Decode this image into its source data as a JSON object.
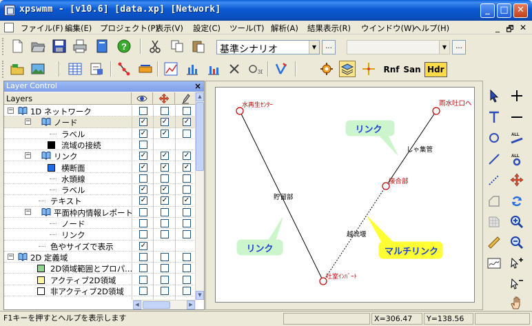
{
  "window": {
    "title": "xpswmm - [v10.6] [data.xp] [Network]",
    "min_glyph": "_",
    "max_glyph": "□",
    "close_glyph": "✕"
  },
  "menu": {
    "items": [
      "ファイル(F)",
      "編集(E)",
      "プロジェクト(P)",
      "表示(V)",
      "設定(C)",
      "ツール(T)",
      "解析(A)",
      "結果表示(R)",
      "ウインドウ(W)",
      "ヘルプ(H)"
    ],
    "mdi_min": "_",
    "mdi_restore": "🗗",
    "mdi_close": "✕"
  },
  "toolbar": {
    "scenario_value": "基準シナリオ",
    "second_combo_value": "",
    "dots": "...",
    "rnf_label": "Rnf",
    "san_label": "San",
    "hdr_label": "Hdr"
  },
  "layer_control": {
    "title": "Layer Control",
    "close_glyph": "×",
    "header_label": "Layers",
    "rows": [
      {
        "name": "1D ネットワーク",
        "c1": false,
        "c2": false,
        "c3": false
      },
      {
        "name": "ノード",
        "c1": true,
        "c2": true,
        "c3": true
      },
      {
        "name": "ラベル",
        "c1": true,
        "c2": true,
        "c3": false
      },
      {
        "name": "流域の接続",
        "c1": false,
        "c2": null,
        "c3": null
      },
      {
        "name": "リンク",
        "c1": true,
        "c2": true,
        "c3": true
      },
      {
        "name": "横断面",
        "c1": true,
        "c2": true,
        "c3": true
      },
      {
        "name": "水頭線",
        "c1": false,
        "c2": false,
        "c3": false
      },
      {
        "name": "ラベル",
        "c1": true,
        "c2": true,
        "c3": false
      },
      {
        "name": "テキスト",
        "c1": true,
        "c2": true,
        "c3": true
      },
      {
        "name": "平面枠内情報レポート",
        "c1": false,
        "c2": false,
        "c3": false
      },
      {
        "name": "ノード",
        "c1": false,
        "c2": false,
        "c3": false
      },
      {
        "name": "リンク",
        "c1": false,
        "c2": false,
        "c3": false
      },
      {
        "name": "色やサイズで表示",
        "c1": true,
        "c2": null,
        "c3": null
      },
      {
        "name": "2D 定義域",
        "c1": false,
        "c2": false,
        "c3": false
      },
      {
        "name": "2D領域範囲とプロパ...",
        "c1": false,
        "c2": false,
        "c3": false
      },
      {
        "name": "アクティブ2D領域",
        "c1": false,
        "c2": false,
        "c3": false
      },
      {
        "name": "非アクティブ2D領域",
        "c1": false,
        "c2": false,
        "c3": false
      }
    ]
  },
  "network": {
    "nodes": [
      {
        "label": "水再生ｾﾝﾀｰ"
      },
      {
        "label": "雨水吐口へ"
      },
      {
        "label": "接合部"
      },
      {
        "label": "吐室ｲﾝﾊﾞｰﾄ"
      }
    ],
    "link_labels": [
      "貯留部",
      "しゃ集管",
      "越流堰"
    ],
    "callouts": {
      "link_top": "リンク",
      "link_bottom": "リンク",
      "multilink": "マルチリンク"
    },
    "colors": {
      "node": "#c00000",
      "callout_link": "#ccf5cc",
      "callout_multilink": "#ffff33"
    }
  },
  "status": {
    "help": "F1キーを押すとヘルプを表示します",
    "x_readout": "X=306.47",
    "y_readout": "Y=138.56"
  }
}
